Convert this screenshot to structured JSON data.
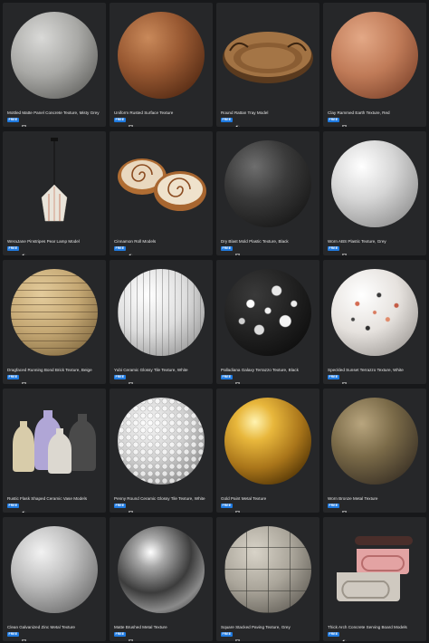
{
  "cards": [
    {
      "title": "Mottled Matte Panel Concrete Texture, Misty Grey",
      "badge": "FREE",
      "icon": "texture-icon"
    },
    {
      "title": "Uniform Rusted Surface Texture",
      "badge": "FREE",
      "icon": "texture-icon"
    },
    {
      "title": "Round Rattan Tray Model",
      "badge": "FREE",
      "icon": "model-icon"
    },
    {
      "title": "Clay Rammed Earth Texture, Red",
      "badge": "FREE",
      "icon": "texture-icon"
    },
    {
      "title": "WeraJane Pinstripes Pear Lamp Model",
      "badge": "FREE",
      "icon": "model-icon"
    },
    {
      "title": "Cinnamon Roll Models",
      "badge": "FREE",
      "icon": "model-icon"
    },
    {
      "title": "Dry Blast Mold Plastic Texture, Black",
      "badge": "FREE",
      "icon": "texture-icon"
    },
    {
      "title": "Worn ABS Plastic Texture, Grey",
      "badge": "FREE",
      "icon": "texture-icon"
    },
    {
      "title": "Dragfaced Running Bond Brick Texture, Beige",
      "badge": "FREE",
      "icon": "texture-icon"
    },
    {
      "title": "Yubi Ceramic Glossy Tile Texture, White",
      "badge": "FREE",
      "icon": "texture-icon"
    },
    {
      "title": "Palladiana Galaxy Terrazzo Texture, Black",
      "badge": "FREE",
      "icon": "texture-icon"
    },
    {
      "title": "Speckled Sunset Terrazzo Texture, White",
      "badge": "FREE",
      "icon": "texture-icon"
    },
    {
      "title": "Rustic Flask Shaped Ceramic Vase Models",
      "badge": "FREE",
      "icon": "model-icon"
    },
    {
      "title": "Penny Round Ceramic Glossy Tile Texture, White",
      "badge": "FREE",
      "icon": "texture-icon"
    },
    {
      "title": "Gold Paint Metal Texture",
      "badge": "FREE",
      "icon": "texture-icon"
    },
    {
      "title": "Worn Bronze Metal Texture",
      "badge": "FREE",
      "icon": "texture-icon"
    },
    {
      "title": "Clean Galvanized Zinc Metal Texture",
      "badge": "FREE",
      "icon": "texture-icon"
    },
    {
      "title": "Matte Brushed Metal Texture",
      "badge": "FREE",
      "icon": "texture-icon"
    },
    {
      "title": "Square Stacked Paving Texture, Grey",
      "badge": "FREE",
      "icon": "texture-icon"
    },
    {
      "title": "Thick Arch Concrete Serving Board Models",
      "badge": "FREE",
      "icon": "model-icon"
    }
  ]
}
